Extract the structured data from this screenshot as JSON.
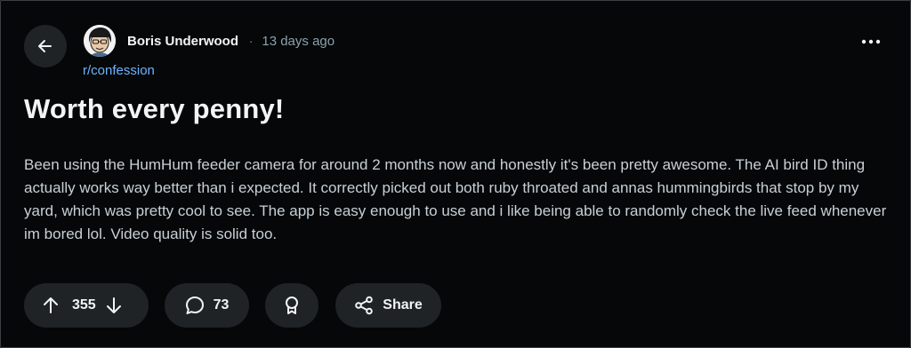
{
  "post": {
    "author": "Boris Underwood",
    "separator": "·",
    "time_ago": "13 days ago",
    "subreddit": "r/confession",
    "title": "Worth every penny!",
    "body": "Been using the HumHum feeder camera for around 2 months now and honestly it's been pretty awesome. The AI bird ID thing actually works way better than i expected. It correctly picked out both ruby throated and annas hummingbirds that stop by my yard, which was pretty cool to see. The app is easy enough to use and i like being able to randomly check the live feed whenever im bored lol. Video quality is solid too."
  },
  "actions": {
    "score": "355",
    "comments": "73",
    "share_label": "Share"
  },
  "icons": {
    "back": "arrow-left-icon",
    "more": "more-horizontal-icon",
    "upvote": "arrow-up-icon",
    "downvote": "arrow-down-icon",
    "comment": "comment-bubble-icon",
    "award": "award-icon",
    "share": "share-icon"
  },
  "colors": {
    "background": "#050708",
    "pill": "#1f2326",
    "subreddit_link": "#6fb3ff",
    "muted_text": "#8ba2ad"
  }
}
